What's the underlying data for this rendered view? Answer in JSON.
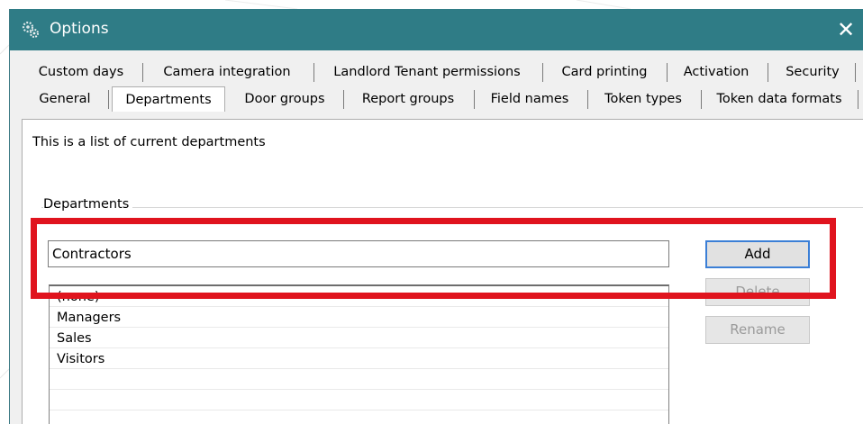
{
  "window": {
    "title": "Options",
    "close_glyph": "✕"
  },
  "tabs_row1": [
    {
      "label": "Custom days"
    },
    {
      "label": "Camera integration"
    },
    {
      "label": "Landlord Tenant permissions"
    },
    {
      "label": "Card printing"
    },
    {
      "label": "Activation"
    },
    {
      "label": "Security"
    }
  ],
  "tabs_row2": [
    {
      "label": "General"
    },
    {
      "label": "Departments",
      "active": true
    },
    {
      "label": "Door groups"
    },
    {
      "label": "Report groups"
    },
    {
      "label": "Field names"
    },
    {
      "label": "Token types"
    },
    {
      "label": "Token data formats"
    }
  ],
  "panel": {
    "description": "This is a list of current departments",
    "group_label": "Departments",
    "input_value": "Contractors",
    "buttons": {
      "add": "Add",
      "delete": "Delete",
      "rename": "Rename"
    },
    "list_items": [
      "(none)",
      "Managers",
      "Sales",
      "Visitors"
    ]
  },
  "colors": {
    "titlebar": "#2f7c86",
    "highlight": "#e0141e",
    "default_button_border": "#3b7fd6"
  },
  "icons": {
    "app": "gears-icon",
    "close": "close-icon"
  }
}
